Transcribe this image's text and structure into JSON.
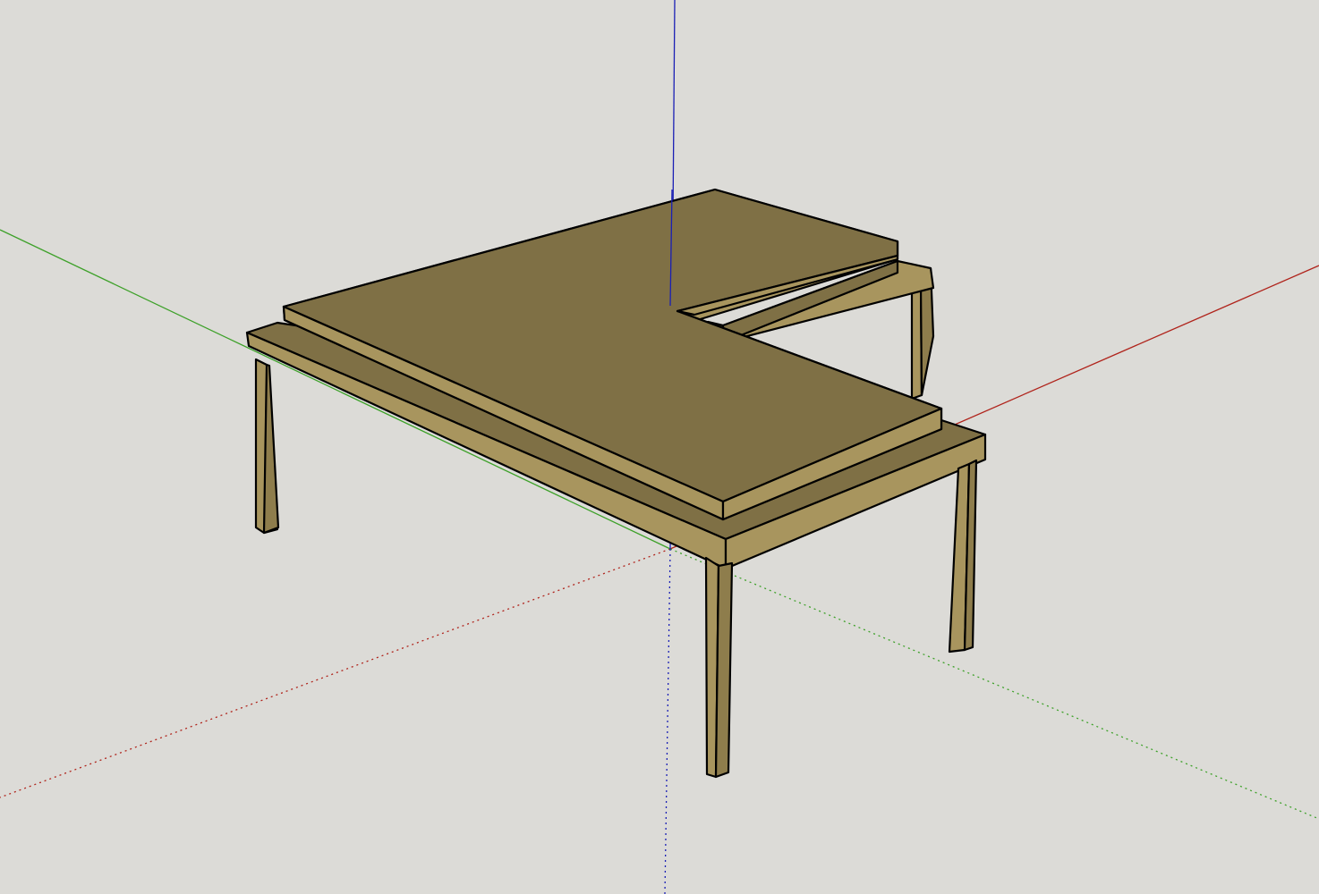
{
  "app": {
    "background_color": "#dcdbd7"
  },
  "axes": {
    "red_axis": {
      "color": "#b0241c",
      "style": "solid-positive, dotted-negative"
    },
    "green_axis": {
      "color": "#3ea12a",
      "style": "solid-positive, dotted-negative"
    },
    "blue_axis": {
      "color": "#1a1fb5",
      "style": "solid-positive, dotted-negative"
    }
  },
  "model": {
    "object": "L-shaped desk",
    "colors": {
      "top_face": "#7f7045",
      "light_face": "#a8955e",
      "dark_face": "#8e7d4c",
      "edge": "#000000"
    }
  }
}
